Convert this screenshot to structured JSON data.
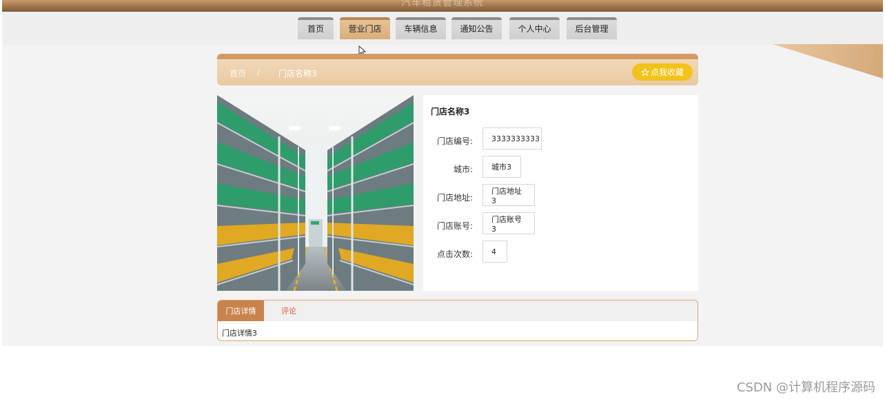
{
  "site_title": "汽车租赁管理系统",
  "nav": {
    "items": [
      "首页",
      "营业门店",
      "车辆信息",
      "通知公告",
      "个人中心",
      "后台管理"
    ],
    "active_index": 1
  },
  "breadcrumb": {
    "home": "首页",
    "separator": "/",
    "current": "门店名称3"
  },
  "favorite_button": {
    "icon": "star-outline-icon",
    "label": "点我收藏"
  },
  "store": {
    "name": "门店名称3",
    "fields": [
      {
        "label": "门店编号:",
        "value": "3333333333"
      },
      {
        "label": "城市:",
        "value": "城市3"
      },
      {
        "label": "门店地址:",
        "value": "门店地址3"
      },
      {
        "label": "门店账号:",
        "value": "门店账号3"
      },
      {
        "label": "点击次数:",
        "value": "4"
      }
    ]
  },
  "tabs": {
    "items": [
      "门店详情",
      "评论"
    ],
    "active_index": 0,
    "content": "门店详情3"
  },
  "watermark": "CSDN @计算机程序源码",
  "colors": {
    "accent": "#c8844c",
    "nav_active": "#e6c296",
    "favorite": "#f2c31a",
    "tab_inactive_text": "#e2573b"
  }
}
